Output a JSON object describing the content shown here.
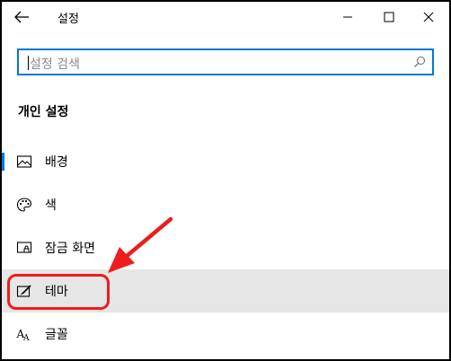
{
  "window": {
    "title": "설정"
  },
  "search": {
    "placeholder": "설정 검색",
    "value": ""
  },
  "section": {
    "title": "개인 설정"
  },
  "nav": [
    {
      "label": "배경",
      "icon": "picture-icon"
    },
    {
      "label": "색",
      "icon": "palette-icon"
    },
    {
      "label": "잠금 화면",
      "icon": "lock-screen-icon"
    },
    {
      "label": "테마",
      "icon": "theme-icon"
    },
    {
      "label": "글꼴",
      "icon": "font-icon"
    }
  ],
  "colors": {
    "accent": "#0078d7",
    "annotation": "#ee1c1c",
    "selected_bg": "#e6e6e6"
  }
}
